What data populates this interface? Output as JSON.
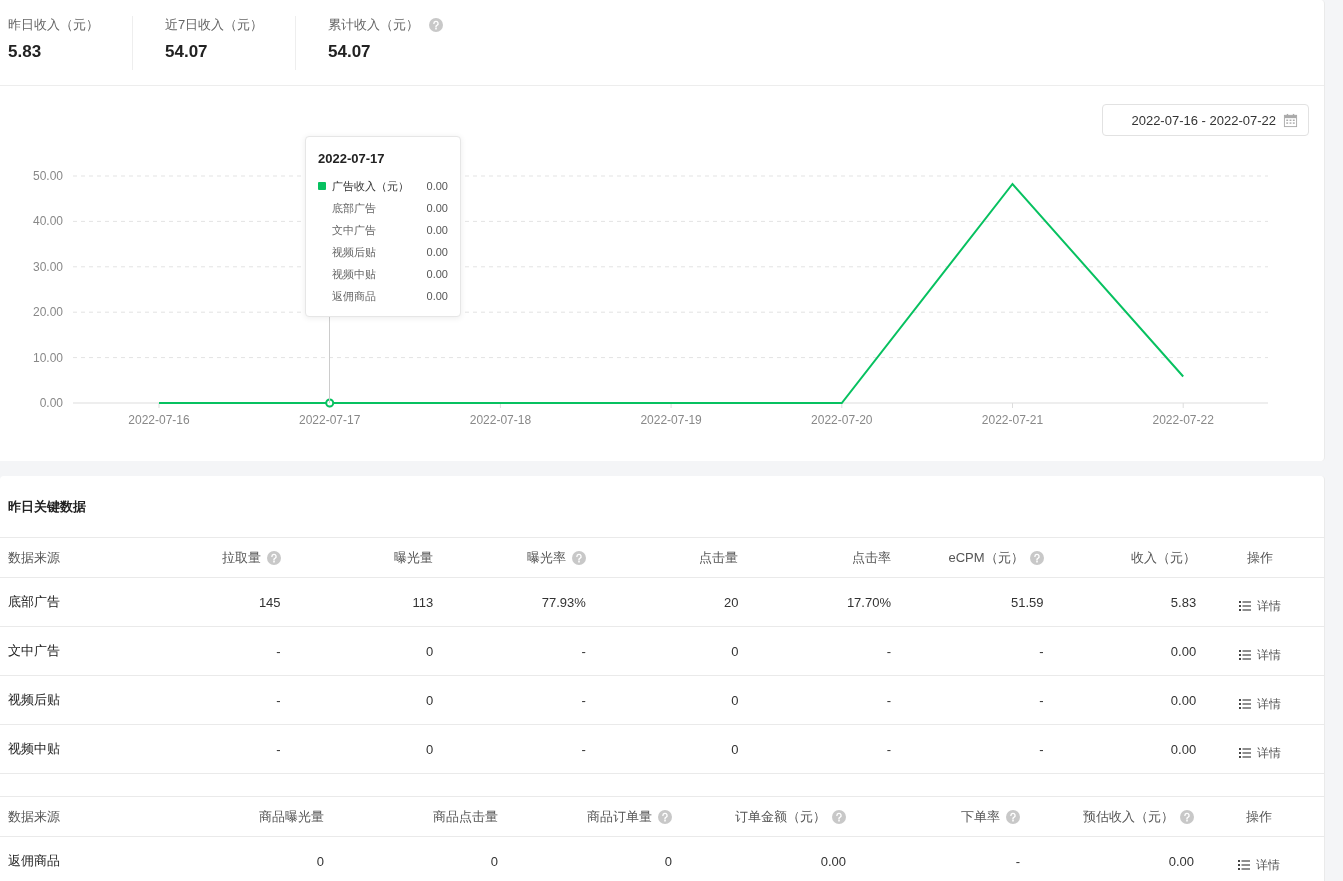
{
  "summary": [
    {
      "label": "昨日收入（元）",
      "value": "5.83",
      "help": false
    },
    {
      "label": "近7日收入（元）",
      "value": "54.07",
      "help": false
    },
    {
      "label": "累计收入（元）",
      "value": "54.07",
      "help": true
    }
  ],
  "date_range": "2022-07-16 - 2022-07-22",
  "chart": {
    "chart_data": {
      "type": "line",
      "categories": [
        "2022-07-16",
        "2022-07-17",
        "2022-07-18",
        "2022-07-19",
        "2022-07-20",
        "2022-07-21",
        "2022-07-22"
      ],
      "series": [
        {
          "name": "广告收入（元）",
          "color": "#07c160",
          "values": [
            0,
            0,
            0,
            0,
            0,
            48.24,
            5.83
          ]
        }
      ],
      "grid": true,
      "ylim": [
        0,
        50
      ],
      "yticks": [
        {
          "value": 0,
          "label": "0.00"
        },
        {
          "value": 10,
          "label": "10.00"
        },
        {
          "value": 20,
          "label": "20.00"
        },
        {
          "value": 30,
          "label": "30.00"
        },
        {
          "value": 40,
          "label": "40.00"
        },
        {
          "value": 50,
          "label": "50.00"
        }
      ]
    },
    "tooltip": {
      "title": "2022-07-17",
      "series_value": "0.00",
      "rows": [
        {
          "label": "底部广告",
          "value": "0.00"
        },
        {
          "label": "文中广告",
          "value": "0.00"
        },
        {
          "label": "视频后贴",
          "value": "0.00"
        },
        {
          "label": "视频中贴",
          "value": "0.00"
        },
        {
          "label": "返佣商品",
          "value": "0.00"
        }
      ]
    }
  },
  "key_data": {
    "title": "昨日关键数据",
    "columns": [
      {
        "label": "数据来源",
        "help": false
      },
      {
        "label": "拉取量",
        "help": true
      },
      {
        "label": "曝光量",
        "help": false
      },
      {
        "label": "曝光率",
        "help": true
      },
      {
        "label": "点击量",
        "help": false
      },
      {
        "label": "点击率",
        "help": false
      },
      {
        "label": "eCPM（元）",
        "help": true
      },
      {
        "label": "收入（元）",
        "help": false
      },
      {
        "label": "操作",
        "help": false
      }
    ],
    "rows": [
      {
        "cells": [
          "底部广告",
          "145",
          "113",
          "77.93%",
          "20",
          "17.70%",
          "51.59",
          "5.83"
        ],
        "action": "详情"
      },
      {
        "cells": [
          "文中广告",
          "-",
          "0",
          "-",
          "0",
          "-",
          "-",
          "0.00"
        ],
        "action": "详情"
      },
      {
        "cells": [
          "视频后贴",
          "-",
          "0",
          "-",
          "0",
          "-",
          "-",
          "0.00"
        ],
        "action": "详情"
      },
      {
        "cells": [
          "视频中贴",
          "-",
          "0",
          "-",
          "0",
          "-",
          "-",
          "0.00"
        ],
        "action": "详情"
      }
    ]
  },
  "commission": {
    "columns": [
      {
        "label": "数据来源",
        "help": false
      },
      {
        "label": "商品曝光量",
        "help": false
      },
      {
        "label": "商品点击量",
        "help": false
      },
      {
        "label": "商品订单量",
        "help": true
      },
      {
        "label": "订单金额（元）",
        "help": true
      },
      {
        "label": "下单率",
        "help": true
      },
      {
        "label": "预估收入（元）",
        "help": true
      },
      {
        "label": "操作",
        "help": false
      }
    ],
    "rows": [
      {
        "cells": [
          "返佣商品",
          "0",
          "0",
          "0",
          "0.00",
          "-",
          "0.00"
        ],
        "action": "详情"
      }
    ]
  }
}
